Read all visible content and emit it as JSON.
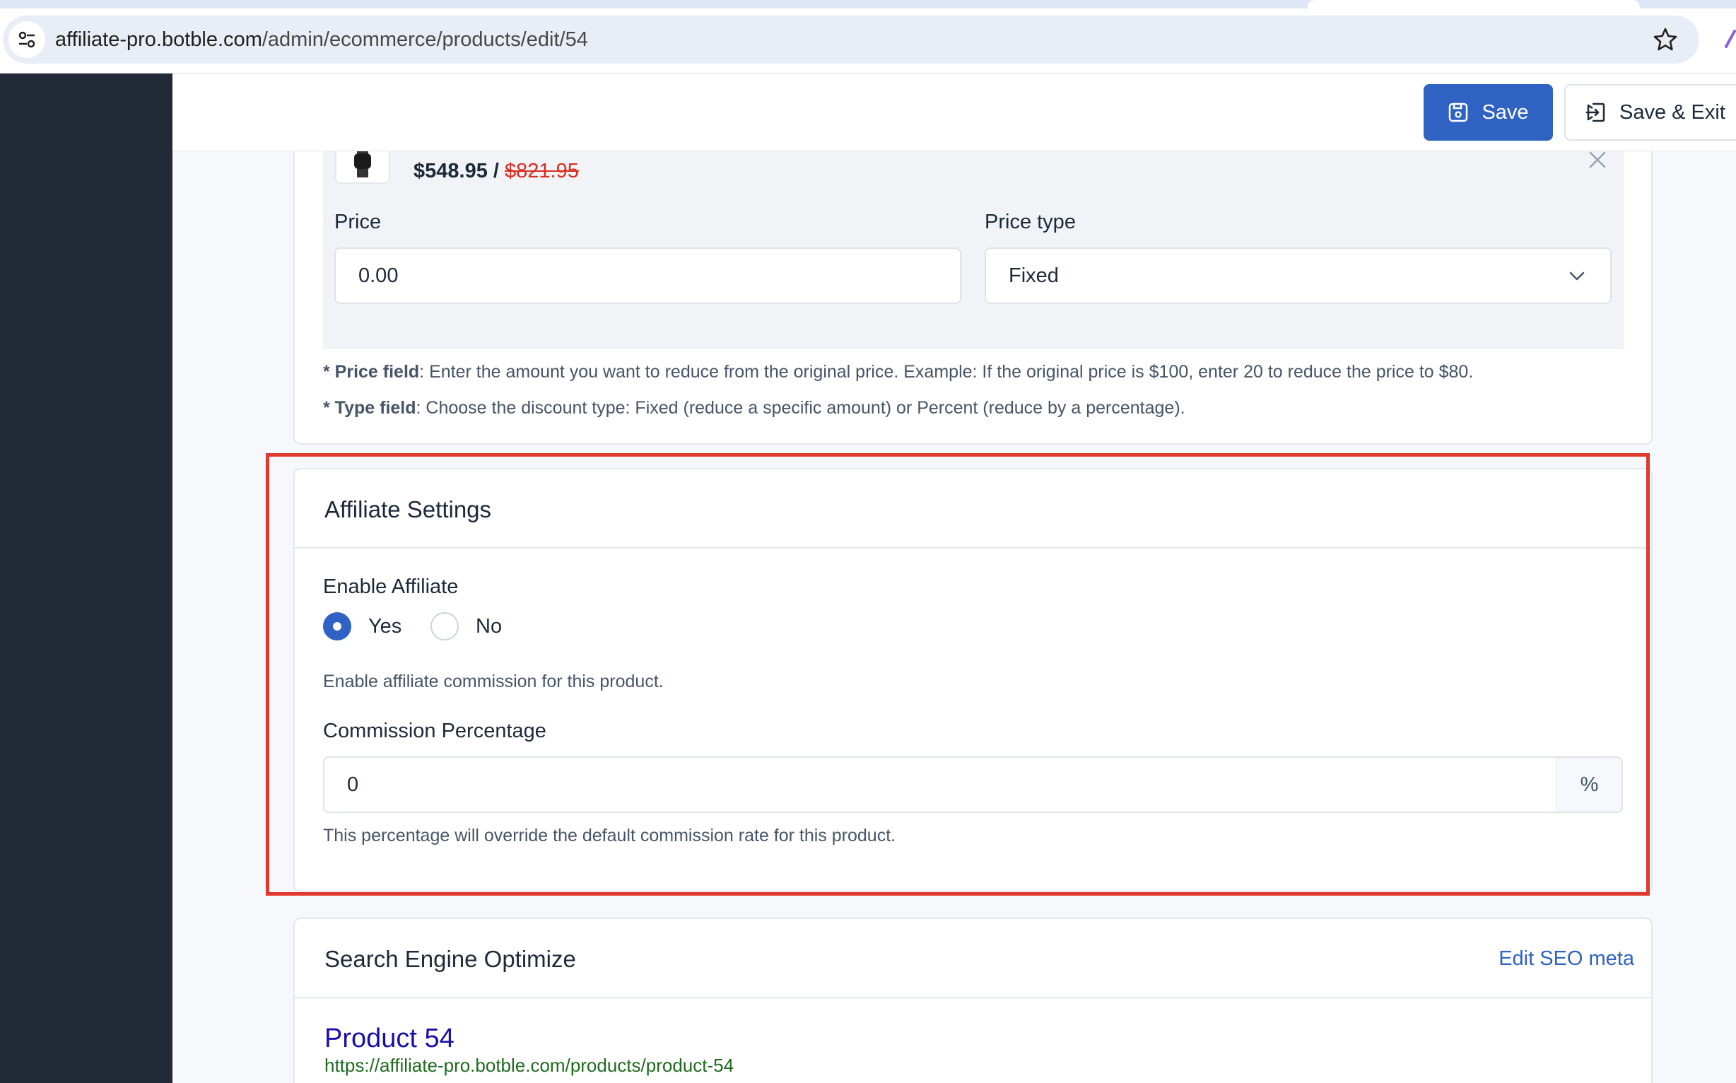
{
  "browser": {
    "url_host": "affiliate-pro.botble.com",
    "url_path": "/admin/ecommerce/products/edit/54",
    "icons": [
      "tune-icon",
      "star-icon"
    ]
  },
  "toolbar": {
    "save_label": "Save",
    "save_exit_label": "Save & Exit",
    "icons": [
      "save-icon",
      "exit-icon"
    ]
  },
  "discount": {
    "sale_price": "$548.95",
    "separator": "/",
    "original_price": "$821.95",
    "price_label": "Price",
    "price_value": "0.00",
    "price_type_label": "Price type",
    "price_type_value": "Fixed",
    "help_price_bold": "* Price field",
    "help_price_text": ": Enter the amount you want to reduce from the original price. Example: If the original price is $100, enter 20 to reduce the price to $80.",
    "help_type_bold": "* Type field",
    "help_type_text": ": Choose the discount type: Fixed (reduce a specific amount) or Percent (reduce by a percentage)."
  },
  "affiliate": {
    "title": "Affiliate Settings",
    "enable_label": "Enable Affiliate",
    "options": [
      {
        "label": "Yes",
        "selected": true
      },
      {
        "label": "No",
        "selected": false
      }
    ],
    "enable_help": "Enable affiliate commission for this product.",
    "commission_label": "Commission Percentage",
    "commission_value": "0",
    "commission_suffix": "%",
    "commission_help": "This percentage will override the default commission rate for this product."
  },
  "seo": {
    "title": "Search Engine Optimize",
    "edit_link": "Edit SEO meta",
    "preview_title": "Product 54",
    "preview_url": "https://affiliate-pro.botble.com/products/product-54"
  },
  "colors": {
    "primary": "#2f62c2",
    "sidebar": "#222a37",
    "highlight": "#e03a2e",
    "strike_price": "#d92d20",
    "seo_title": "#1a0dab",
    "seo_url": "#1e6b1e"
  }
}
